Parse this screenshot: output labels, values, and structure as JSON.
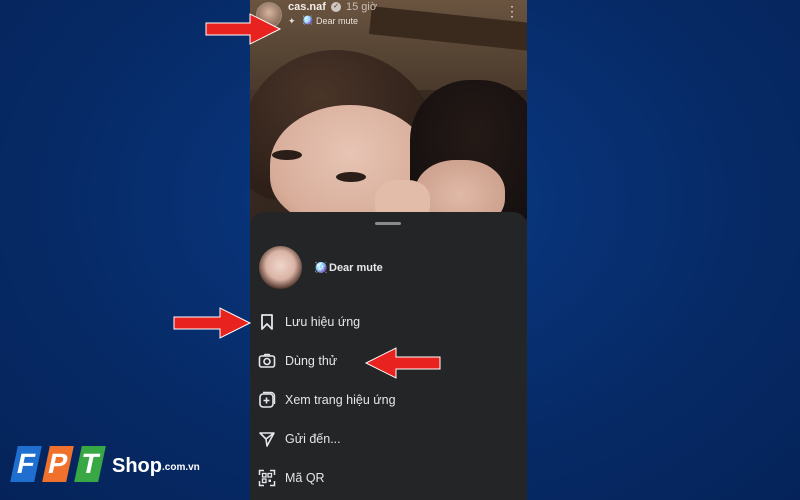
{
  "post_header": {
    "username": "cas.naf",
    "verified_icon": "verified-badge-icon",
    "time_ago": "15 giờ",
    "effect_icon": "sparkle-icon",
    "effect_emoji": "🪩",
    "effect_name": "Dear mute",
    "more_icon": "more-vertical-icon"
  },
  "sheet": {
    "effect_emoji": "🪩",
    "effect_name": "Dear mute",
    "items": [
      {
        "icon": "bookmark-icon",
        "label": "Lưu hiệu ứng"
      },
      {
        "icon": "camera-icon",
        "label": "Dùng thử"
      },
      {
        "icon": "effect-page-icon",
        "label": "Xem trang hiệu ứng"
      },
      {
        "icon": "send-icon",
        "label": "Gửi đến..."
      },
      {
        "icon": "qr-code-icon",
        "label": "Mã QR"
      }
    ]
  },
  "logo": {
    "letters": [
      "F",
      "P",
      "T"
    ],
    "shop": "Shop",
    "tld": ".com.vn",
    "colors": {
      "f": "#1f6fd1",
      "p": "#f0712b",
      "t": "#38a845"
    }
  },
  "colors": {
    "background": "#062a66",
    "sheet": "#242526",
    "arrow": "#e8231f"
  }
}
